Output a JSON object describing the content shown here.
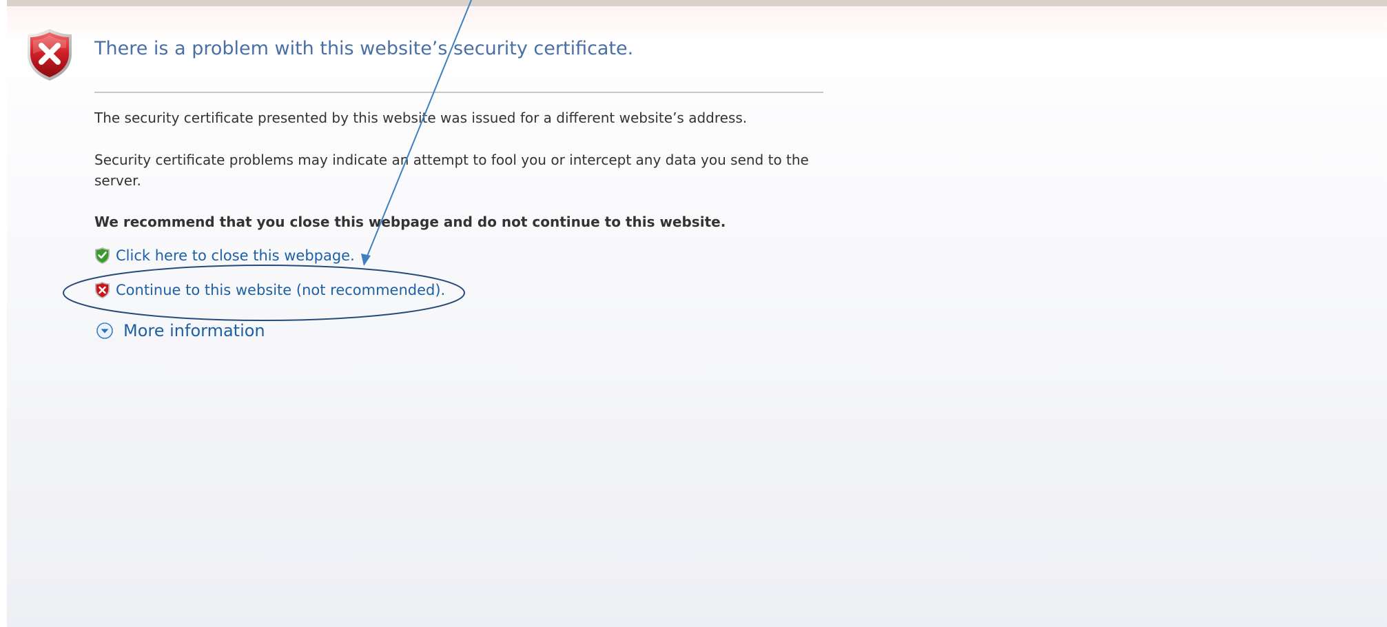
{
  "error": {
    "title": "There is a problem with this website’s security certificate.",
    "paragraph1": "The security certificate presented by this website was issued for a different website’s address.",
    "paragraph2": "Security certificate problems may indicate an attempt to fool you or intercept any data you send to the server.",
    "recommendation": "We recommend that you close this webpage and do not continue to this website."
  },
  "links": {
    "close_page": "Click here to close this webpage.",
    "continue_site": "Continue to this website (not recommended).",
    "more_information": "More information"
  },
  "icons": {
    "header": "shield-error-icon",
    "close_page": "shield-check-icon",
    "continue_site": "shield-error-icon",
    "more_information": "chevron-down-circle-icon"
  },
  "colors": {
    "title": "#4a6fa5",
    "link": "#1e5fa6",
    "body_text": "#333333",
    "error_red": "#c8161d",
    "ok_green": "#3a9a2c",
    "annotation": "#3d7fc1"
  }
}
